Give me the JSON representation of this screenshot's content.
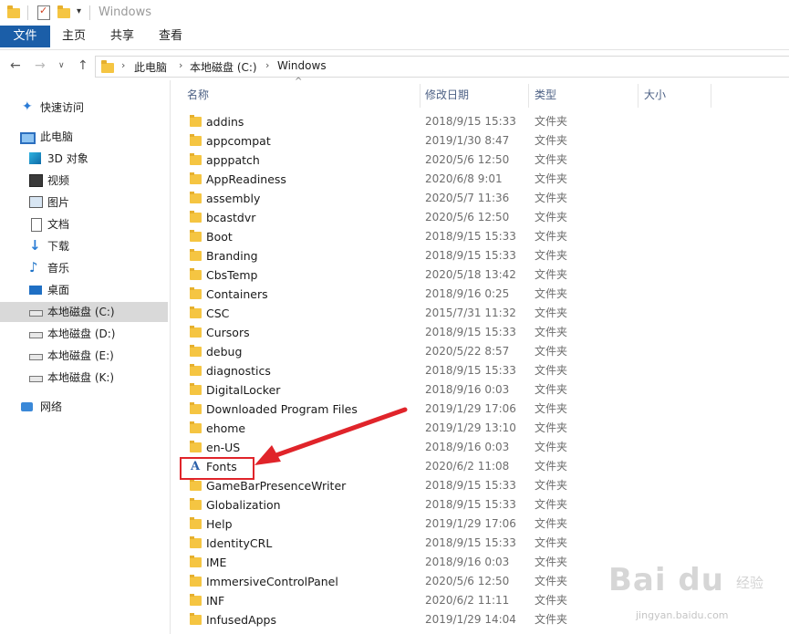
{
  "window": {
    "title": "Windows"
  },
  "ribbon": {
    "tabs": [
      "文件",
      "主页",
      "共享",
      "查看"
    ]
  },
  "address": {
    "crumbs": [
      "此电脑",
      "本地磁盘 (C:)",
      "Windows"
    ]
  },
  "nav": {
    "quick_access": "快速访问",
    "this_pc": "此电脑",
    "items": [
      "3D 对象",
      "视频",
      "图片",
      "文档",
      "下载",
      "音乐",
      "桌面"
    ],
    "drives": [
      "本地磁盘 (C:)",
      "本地磁盘 (D:)",
      "本地磁盘 (E:)",
      "本地磁盘 (K:)"
    ],
    "network": "网络"
  },
  "columns": {
    "name": "名称",
    "date": "修改日期",
    "type": "类型",
    "size": "大小"
  },
  "rows": [
    {
      "name": "addins",
      "date": "2018/9/15 15:33",
      "type": "文件夹"
    },
    {
      "name": "appcompat",
      "date": "2019/1/30 8:47",
      "type": "文件夹"
    },
    {
      "name": "apppatch",
      "date": "2020/5/6 12:50",
      "type": "文件夹"
    },
    {
      "name": "AppReadiness",
      "date": "2020/6/8 9:01",
      "type": "文件夹"
    },
    {
      "name": "assembly",
      "date": "2020/5/7 11:36",
      "type": "文件夹"
    },
    {
      "name": "bcastdvr",
      "date": "2020/5/6 12:50",
      "type": "文件夹"
    },
    {
      "name": "Boot",
      "date": "2018/9/15 15:33",
      "type": "文件夹"
    },
    {
      "name": "Branding",
      "date": "2018/9/15 15:33",
      "type": "文件夹"
    },
    {
      "name": "CbsTemp",
      "date": "2020/5/18 13:42",
      "type": "文件夹"
    },
    {
      "name": "Containers",
      "date": "2018/9/16 0:25",
      "type": "文件夹"
    },
    {
      "name": "CSC",
      "date": "2015/7/31 11:32",
      "type": "文件夹"
    },
    {
      "name": "Cursors",
      "date": "2018/9/15 15:33",
      "type": "文件夹"
    },
    {
      "name": "debug",
      "date": "2020/5/22 8:57",
      "type": "文件夹"
    },
    {
      "name": "diagnostics",
      "date": "2018/9/15 15:33",
      "type": "文件夹"
    },
    {
      "name": "DigitalLocker",
      "date": "2018/9/16 0:03",
      "type": "文件夹"
    },
    {
      "name": "Downloaded Program Files",
      "date": "2019/1/29 17:06",
      "type": "文件夹"
    },
    {
      "name": "ehome",
      "date": "2019/1/29 13:10",
      "type": "文件夹"
    },
    {
      "name": "en-US",
      "date": "2018/9/16 0:03",
      "type": "文件夹"
    },
    {
      "name": "Fonts",
      "date": "2020/6/2 11:08",
      "type": "文件夹",
      "icon": "font-folder-icon"
    },
    {
      "name": "GameBarPresenceWriter",
      "date": "2018/9/15 15:33",
      "type": "文件夹"
    },
    {
      "name": "Globalization",
      "date": "2018/9/15 15:33",
      "type": "文件夹"
    },
    {
      "name": "Help",
      "date": "2019/1/29 17:06",
      "type": "文件夹"
    },
    {
      "name": "IdentityCRL",
      "date": "2018/9/15 15:33",
      "type": "文件夹"
    },
    {
      "name": "IME",
      "date": "2018/9/16 0:03",
      "type": "文件夹"
    },
    {
      "name": "ImmersiveControlPanel",
      "date": "2020/5/6 12:50",
      "type": "文件夹"
    },
    {
      "name": "INF",
      "date": "2020/6/2 11:11",
      "type": "文件夹"
    },
    {
      "name": "InfusedApps",
      "date": "2019/1/29 14:04",
      "type": "文件夹"
    }
  ],
  "watermark": {
    "logo": "Bai du",
    "sub": "经验",
    "url": "jingyan.baidu.com"
  },
  "colors": {
    "file_tab": "#1b5ea8",
    "annotation": "#e0242a",
    "selected_nav": "#d9d9d9"
  }
}
